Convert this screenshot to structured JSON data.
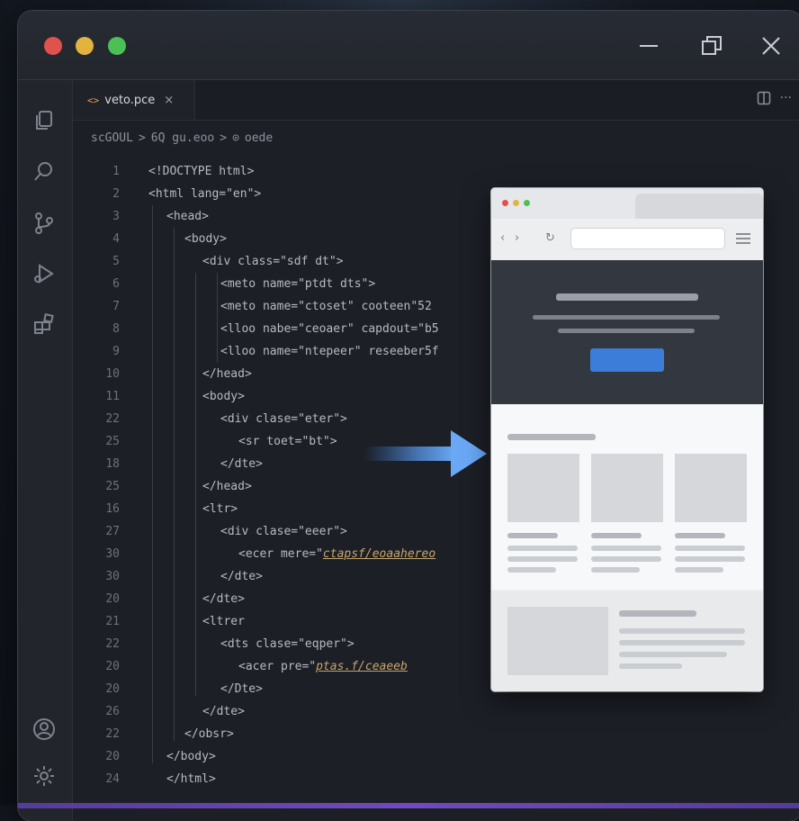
{
  "tab": {
    "icon": "<>",
    "name": "veto.pce",
    "close": "×"
  },
  "breadcrumb": {
    "seg1": "scGOUL",
    "seg2": "6Q gu.eoo",
    "seg3": "oede",
    "sep": ">"
  },
  "code_lines": [
    {
      "n": "1",
      "indent": 0,
      "text": "<!DOCTYPE html>"
    },
    {
      "n": "2",
      "indent": 0,
      "text": "<html lang=\"en\">"
    },
    {
      "n": "3",
      "indent": 1,
      "text": "<head>"
    },
    {
      "n": "4",
      "indent": 2,
      "text": "<body>"
    },
    {
      "n": "5",
      "indent": 3,
      "text": "<div class=\"sdf dt\">"
    },
    {
      "n": "6",
      "indent": 4,
      "text": "<meto name=\"ptdt dts\">"
    },
    {
      "n": "7",
      "indent": 4,
      "text": "<meto name=\"ctoset\" cooteen\"52"
    },
    {
      "n": "8",
      "indent": 4,
      "text": "<lloo nabe=\"ceoaer\" capdout=\"b5"
    },
    {
      "n": "9",
      "indent": 4,
      "text": "<lloo name=\"ntepeer\" reseeber5f"
    },
    {
      "n": "10",
      "indent": 3,
      "text": "</head>"
    },
    {
      "n": "11",
      "indent": 3,
      "text": "<body>"
    },
    {
      "n": "22",
      "indent": 4,
      "text": "<div clase=\"eter\">"
    },
    {
      "n": "25",
      "indent": 5,
      "text": "<sr toet=\"bt\">"
    },
    {
      "n": "18",
      "indent": 4,
      "text": "</dte>"
    },
    {
      "n": "25",
      "indent": 3,
      "text": "</head>"
    },
    {
      "n": "16",
      "indent": 3,
      "text": "<ltr>"
    },
    {
      "n": "27",
      "indent": 4,
      "text": "<div clase=\"eeer\">"
    },
    {
      "n": "30",
      "indent": 5,
      "text": "<ecer mere=\"",
      "link": "ctapsf/eoaahereo"
    },
    {
      "n": "30",
      "indent": 4,
      "text": "</dte>"
    },
    {
      "n": "20",
      "indent": 3,
      "text": "</dte>"
    },
    {
      "n": "21",
      "indent": 3,
      "text": "<ltrer"
    },
    {
      "n": "22",
      "indent": 4,
      "text": "<dts clase=\"eqper\">"
    },
    {
      "n": "20",
      "indent": 5,
      "text": "<acer pre=\"",
      "link": "ptas.f/ceaeeb"
    },
    {
      "n": "20",
      "indent": 4,
      "text": "</Dte>"
    },
    {
      "n": "26",
      "indent": 3,
      "text": "</dte>"
    },
    {
      "n": "22",
      "indent": 2,
      "text": "</obsr>"
    },
    {
      "n": "20",
      "indent": 1,
      "text": "</body>"
    },
    {
      "n": "24",
      "indent": 1,
      "text": "</html>"
    }
  ],
  "colors": {
    "accent": "#3b7dd8",
    "traffic_red": "#e0524e",
    "traffic_yellow": "#e3b340",
    "traffic_green": "#4cbf55",
    "bottom_bar": "#7a4fd0"
  },
  "icons": [
    "files-icon",
    "search-icon",
    "source-control-icon",
    "run-debug-icon",
    "extensions-icon",
    "account-icon",
    "settings-icon"
  ]
}
